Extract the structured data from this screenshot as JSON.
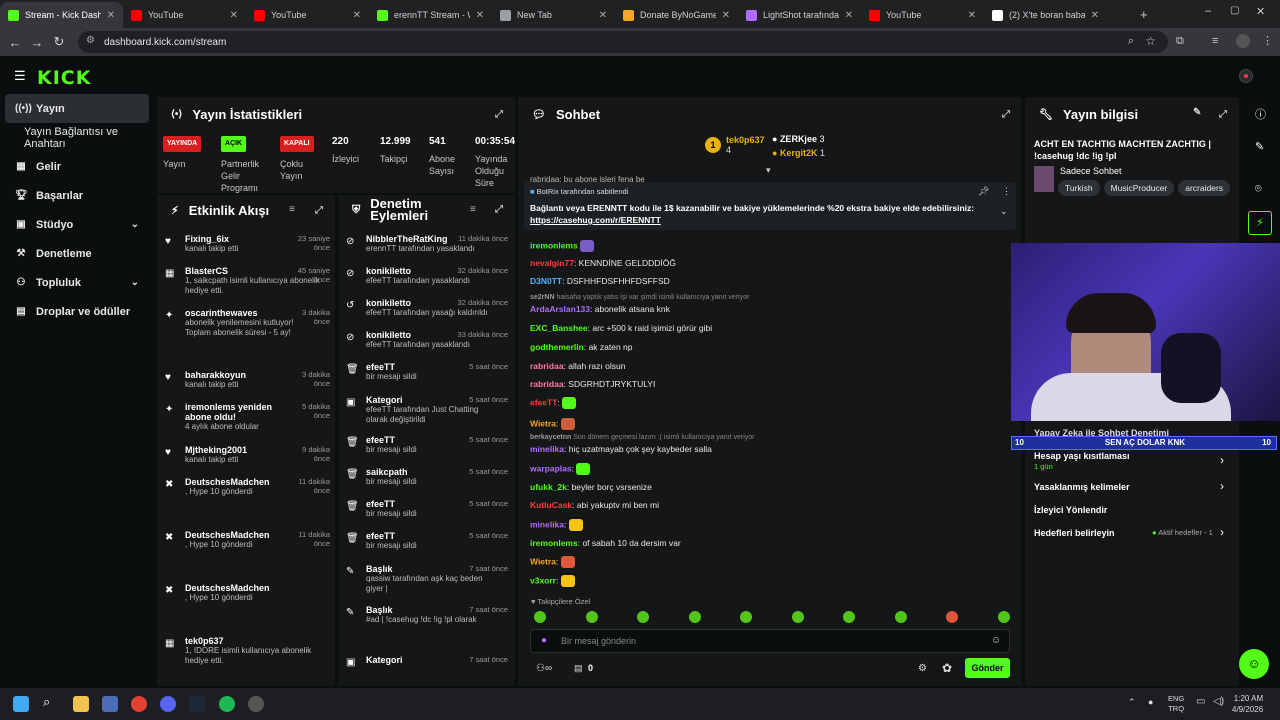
{
  "browser": {
    "tabs": [
      {
        "label": "Stream - Kick Dashboa",
        "color": "#53fc18"
      },
      {
        "label": "YouTube",
        "color": "#ff0000"
      },
      {
        "label": "YouTube",
        "color": "#ff0000"
      },
      {
        "label": "erennTT Stream - Wa",
        "color": "#53fc18"
      },
      {
        "label": "New Tab",
        "color": "#9aa0a6"
      },
      {
        "label": "Donate ByNoGame -",
        "color": "#f5a623"
      },
      {
        "label": "LightShot tarafından",
        "color": "#b36bff"
      },
      {
        "label": "YouTube",
        "color": "#ff0000"
      },
      {
        "label": "(2) X'te boran baba:",
        "color": "#ffffff"
      }
    ],
    "url": "dashboard.kick.com/stream"
  },
  "sidebar": {
    "items": [
      {
        "label": "Yayın",
        "icon": "broadcast-icon"
      },
      {
        "label": "Yayın Bağlantısı ve Anahtarı",
        "icon": ""
      },
      {
        "label": "Gelir",
        "icon": "revenue-icon"
      },
      {
        "label": "Başarılar",
        "icon": "trophy-icon"
      },
      {
        "label": "Stüdyo",
        "icon": "studio-icon"
      },
      {
        "label": "Denetleme",
        "icon": "gavel-icon"
      },
      {
        "label": "Topluluk",
        "icon": "community-icon"
      },
      {
        "label": "Droplar ve ödüller",
        "icon": "gift-icon"
      }
    ]
  },
  "stats": {
    "title": "Yayın İstatistikleri",
    "yayin": {
      "badge": "YAYINDA",
      "label": "Yayın"
    },
    "partner": {
      "badge": "AÇIK",
      "label": "Partnerlik Gelir Programı"
    },
    "multi": {
      "badge": "KAPALI",
      "label": "Çoklu Yayın"
    },
    "viewers": {
      "value": "220",
      "label": "İzleyici"
    },
    "followers": {
      "value": "12.999",
      "label": "Takipçi"
    },
    "subs": {
      "value": "541",
      "label": "Abone Sayısı"
    },
    "uptime": {
      "value": "00:35:54",
      "label": "Yayında Olduğu Süre"
    }
  },
  "activity": {
    "title": "Etkinlik Akışı",
    "items": [
      {
        "name": "Fixing_6ix",
        "text": "kanalı takip etti",
        "time": "23 saniye önce"
      },
      {
        "name": "BlasterCS",
        "text": "1, saikcpath isimli kullanıcıya abonelik hediye etti.",
        "time": "45 saniye önce"
      },
      {
        "name": "oscarinthewaves",
        "text": "abonelik yenilemesini kutluyor! Toplam abonelik süresi - 5 ay!",
        "time": "3 dakika önce"
      },
      {
        "name": "baharakkoyun",
        "text": "kanalı takip etti",
        "time": "3 dakika önce"
      },
      {
        "name": "iremonlems yeniden abone oldu!",
        "text": "4 aylık abone oldular",
        "time": "5 dakika önce"
      },
      {
        "name": "Mjtheking2001",
        "text": "kanalı takip etti",
        "time": "9 dakika önce"
      },
      {
        "name": "DeutschesMadchen",
        "text": ", Hype 10 gönderdi",
        "time": "11 dakika önce"
      },
      {
        "name": "DeutschesMadchen",
        "text": ", Hype 10 gönderdi",
        "time": "11 dakika önce"
      },
      {
        "name": "DeutschesMadchen",
        "text": ", Hype 10 gönderdi",
        "time": ""
      },
      {
        "name": "tek0p637",
        "text": "1, IDORE isimli kullanıcıya abonelik hediye etti.",
        "time": ""
      }
    ]
  },
  "moderation": {
    "title": "Denetim Eylemleri",
    "items": [
      {
        "name": "NibblerTheRatKing",
        "text": "erennTT tarafından yasaklandı",
        "time": "11 dakika önce"
      },
      {
        "name": "konikiletto",
        "text": "efeeTT tarafından yasaklandı",
        "time": "32 dakika önce"
      },
      {
        "name": "konikiletto",
        "text": "efeeTT tarafından yasağı kaldırıldı",
        "time": "32 dakika önce"
      },
      {
        "name": "konikiletto",
        "text": "efeeTT tarafından yasaklandı",
        "time": "33 dakika önce"
      },
      {
        "name": "efeeTT",
        "text": "bir mesajı sildi",
        "time": "5 saat önce"
      },
      {
        "name": "Kategori",
        "text": "efeeTT tarafından Just Chatting olarak değiştirildi",
        "time": "5 saat önce"
      },
      {
        "name": "efeeTT",
        "text": "bir mesajı sildi",
        "time": "5 saat önce"
      },
      {
        "name": "saikcpath",
        "text": "bir mesajı sildi",
        "time": "5 saat önce"
      },
      {
        "name": "efeeTT",
        "text": "bir mesajı sildi",
        "time": "5 saat önce"
      },
      {
        "name": "efeeTT",
        "text": "bir mesajı sildi",
        "time": "5 saat önce"
      },
      {
        "name": "Başlık",
        "text": "qassiw tarafından aşk kaç beden giyer |",
        "time": "7 saat önce"
      },
      {
        "name": "Başlık",
        "text": "#ad | !casehug !dc !ig !pl olarak",
        "time": "7 saat önce"
      },
      {
        "name": "Kategori",
        "text": "",
        "time": "7 saat önce"
      }
    ]
  },
  "chat": {
    "title": "Sohbet",
    "top": [
      {
        "name": "tek0p637",
        "count": "4"
      },
      {
        "name": "ZERKjee",
        "count": "3"
      },
      {
        "name": "Kergit2K",
        "count": "1"
      }
    ],
    "pinned_by": "BotRix tarafından sabitlendi",
    "pinned_text": "Bağlantı veya ERENNTT kodu ile 1$ kazanabilir ve bakiye yüklemelerinde %20 ekstra bakiye elde edebilirsiniz:",
    "pinned_link": "https://casehug.com/r/ERENNTT",
    "messages": [
      {
        "user": "iremonlems",
        "color": "#53fc18",
        "text": ""
      },
      {
        "user": "nevalgin77",
        "color": "#ff3b3b",
        "text": ": KENNDİNE GELDDDİÖĞ"
      },
      {
        "user": "D3N0TT",
        "color": "#53b0ff",
        "text": ": DSFHHFDSFHHFDSFFSD"
      },
      {
        "user": "se2rNN",
        "color": "#9a9a9a",
        "text": " haisaha yaptık yatıs işi var şimdi isimli kullanıcıya yanıt veriyor"
      },
      {
        "user": "ArdaArslan133",
        "color": "#b36bff",
        "text": ": abonelik atsana knk"
      },
      {
        "user": "EXC_Banshee",
        "color": "#53fc18",
        "text": ": arc +500 k raid işimizi görür gibi"
      },
      {
        "user": "godthemerlin",
        "color": "#53fc18",
        "text": ": ak zaten np"
      },
      {
        "user": "rabridaa",
        "color": "#ff7aa8",
        "text": ": allah razı olsun"
      },
      {
        "user": "rabridaa",
        "color": "#ff7aa8",
        "text": ": SDGRHDTJRYKTULYI"
      },
      {
        "user": "efeeTT",
        "color": "#ff3b3b",
        "text": ":"
      },
      {
        "user": "Wietra",
        "color": "#f5a623",
        "text": ":"
      },
      {
        "user": "berkaycetnn",
        "color": "#9a9a9a",
        "text": " Son dönem geçmesi lazım :( isimli kullanıcıya yanıt veriyor"
      },
      {
        "user": "minelika",
        "color": "#b36bff",
        "text": ": hiç uzatmayab çok şey kaybeder salla"
      },
      {
        "user": "warpaplas",
        "color": "#b36bff",
        "text": ":"
      },
      {
        "user": "ufukk_2k",
        "color": "#53fc18",
        "text": ": beyler borç vsrsenize"
      },
      {
        "user": "KutluCask",
        "color": "#ff3b3b",
        "text": ": abi yakuptv mi ben mi"
      },
      {
        "user": "minelika",
        "color": "#b36bff",
        "text": ":"
      },
      {
        "user": "iremonlems",
        "color": "#53fc18",
        "text": ": of sabah 10 da dersim var"
      },
      {
        "user": "Wietra",
        "color": "#f5a623",
        "text": ":"
      },
      {
        "user": "v3xorr",
        "color": "#53fc18",
        "text": ":"
      }
    ],
    "followers_only": "Takipçilere Özel",
    "input_placeholder": "Bir mesaj gönderin",
    "points": "0",
    "send_label": "Gönder",
    "top_trunc": "rabridaa: bu abone işleri fena be"
  },
  "info": {
    "title": "Yayın bilgisi",
    "stream_title": "ACHT EN TACHTIG MACHTEN ZACHTIG | !casehug !dc !ig !pl",
    "category": "Sadece Sohbet",
    "tags": [
      "Turkish",
      "MusicProducer",
      "arcraiders"
    ],
    "ai_moderation": "Yapay Zeka ile Sohbet Denetimi",
    "account_age": "Hesap yaşı kısıtlaması",
    "account_age_val": "1 gün",
    "banned_words": "Yasaklanmış kelimeler",
    "viewer_redirect": "İzleyici Yönlendir",
    "goals": "Hedefleri belirleyin",
    "goals_status": "Aktif hedefler - 1"
  },
  "overlay": {
    "goal_left": "10",
    "goal_text": "SEN AÇ DOLAR KNK",
    "goal_right": "10"
  },
  "taskbar": {
    "lang": "ENG",
    "lang2": "TRQ",
    "time": "1:20 AM",
    "date": "4/9/2026"
  }
}
